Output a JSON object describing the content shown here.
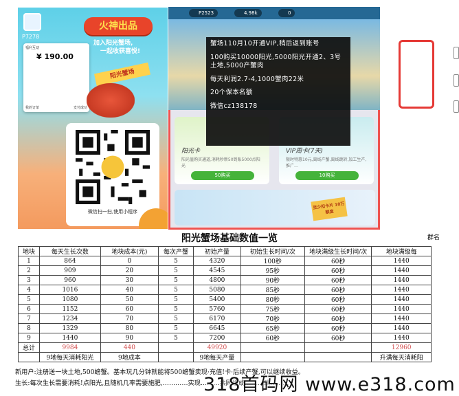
{
  "left_promo": {
    "user_id": "P7278",
    "brand": "火神出品",
    "slogan_line1": "加入阳光蟹场,",
    "slogan_line2": "一起收获喜悦!",
    "ribbon": "阳光蟹场",
    "pay_card": {
      "merchant": "福利互动",
      "amount": "¥ 190.00",
      "left_action": "我的订单",
      "right_action": "支付成功"
    },
    "qr_caption": "微信扫一扫,使用小程序"
  },
  "game": {
    "stats": [
      "P2523",
      "4.98k",
      "0"
    ],
    "overlay": [
      "蟹场110月10开通VIP,稍后返到账号",
      "100购买10000阳光,5000阳光开通2、3号土地,5000产蟹肉",
      "每天利润2.7-4,1000蟹肉22米",
      "20个保本名额",
      "微信cz138178"
    ],
    "card1": {
      "title": "阳光卡",
      "desc": "阳光值购买通道,消耗秒新50到账5000点阳光",
      "button": "50购买"
    },
    "card2": {
      "title": "VIP周卡(7天)",
      "desc": "限时特惠10元,离线产蟹,离线跳转,加工生产,推广…",
      "button": "10购买"
    },
    "badge": "至少扣卡片 10万额度"
  },
  "table": {
    "title": "阳光蟹场基础数值一览",
    "side_label": "群名",
    "headers": [
      "地块",
      "每天生长次数",
      "地块成本(元)",
      "每次产蟹",
      "初始产量",
      "初始生长时间/次",
      "地块满级生长时间/次",
      "地块满级每"
    ],
    "rows": [
      [
        "1",
        "864",
        "0",
        "5",
        "4320",
        "100秒",
        "60秒",
        "1440"
      ],
      [
        "2",
        "909",
        "20",
        "5",
        "4545",
        "95秒",
        "60秒",
        "1440"
      ],
      [
        "3",
        "960",
        "30",
        "5",
        "4800",
        "90秒",
        "60秒",
        "1440"
      ],
      [
        "4",
        "1016",
        "40",
        "5",
        "5080",
        "85秒",
        "60秒",
        "1440"
      ],
      [
        "5",
        "1080",
        "50",
        "5",
        "5400",
        "80秒",
        "60秒",
        "1440"
      ],
      [
        "6",
        "1152",
        "60",
        "5",
        "5760",
        "75秒",
        "60秒",
        "1440"
      ],
      [
        "7",
        "1234",
        "70",
        "5",
        "6170",
        "70秒",
        "60秒",
        "1440"
      ],
      [
        "8",
        "1329",
        "80",
        "5",
        "6645",
        "65秒",
        "60秒",
        "1440"
      ],
      [
        "9",
        "1440",
        "90",
        "5",
        "7200",
        "60秒",
        "60秒",
        "1440"
      ]
    ],
    "total": [
      "总计",
      "9984",
      "440",
      "",
      "49920",
      "",
      "",
      "12960"
    ],
    "footer": [
      "",
      "9地每天消耗阳光",
      "9地成本",
      "",
      "9地每天产量",
      "",
      "",
      "升满每天消耗阳"
    ]
  },
  "notes": {
    "line1": "新用户:注册送一块土地,500螃蟹。基本玩几分钟就能将500螃蟹卖现·充值!卡·后续产蟹,可以继续收益。",
    "line2": "生长:每次生长需要消耗!点阳光,且随机几率需要施肥,…………实现………共同组成………缺………"
  },
  "watermark": "318首码网 www.e318.com"
}
